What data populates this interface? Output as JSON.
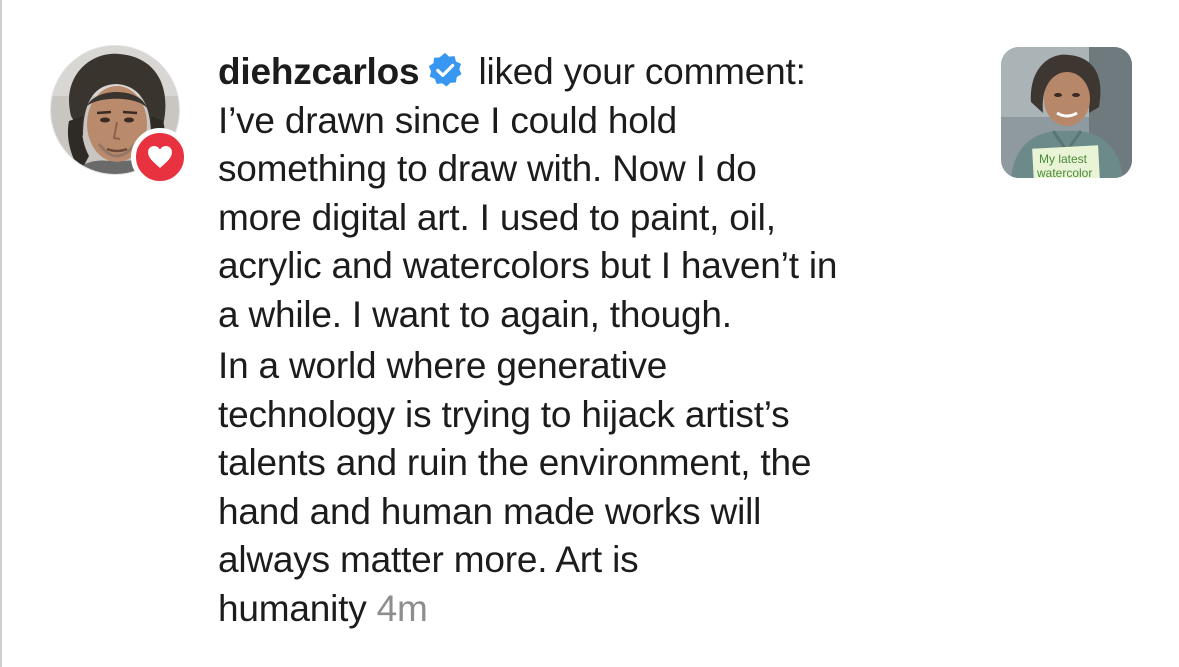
{
  "notification": {
    "username": "diehzcarlos",
    "action_text": " liked your comment:",
    "comment_lines_1": [
      "I’ve drawn since I could hold",
      "something to draw with. Now I do",
      "more digital art. I used to paint, oil,",
      "acrylic and watercolors but I haven’t in",
      "a while. I want to again, though."
    ],
    "comment_lines_2": [
      "In a world where generative",
      "technology is trying to hijack artist’s",
      "talents and ruin the environment, the",
      "hand and human made works will",
      "always matter more. Art is"
    ],
    "comment_last_word": "humanity",
    "timestamp": "4m",
    "badge_icon": "heart-icon",
    "verified_icon": "verified-badge-icon",
    "badge_color": "#e8323f",
    "verified_color": "#3897f0"
  },
  "thumbnail": {
    "overlay_text_line1": "My latest",
    "overlay_text_line2": "watercolor"
  }
}
